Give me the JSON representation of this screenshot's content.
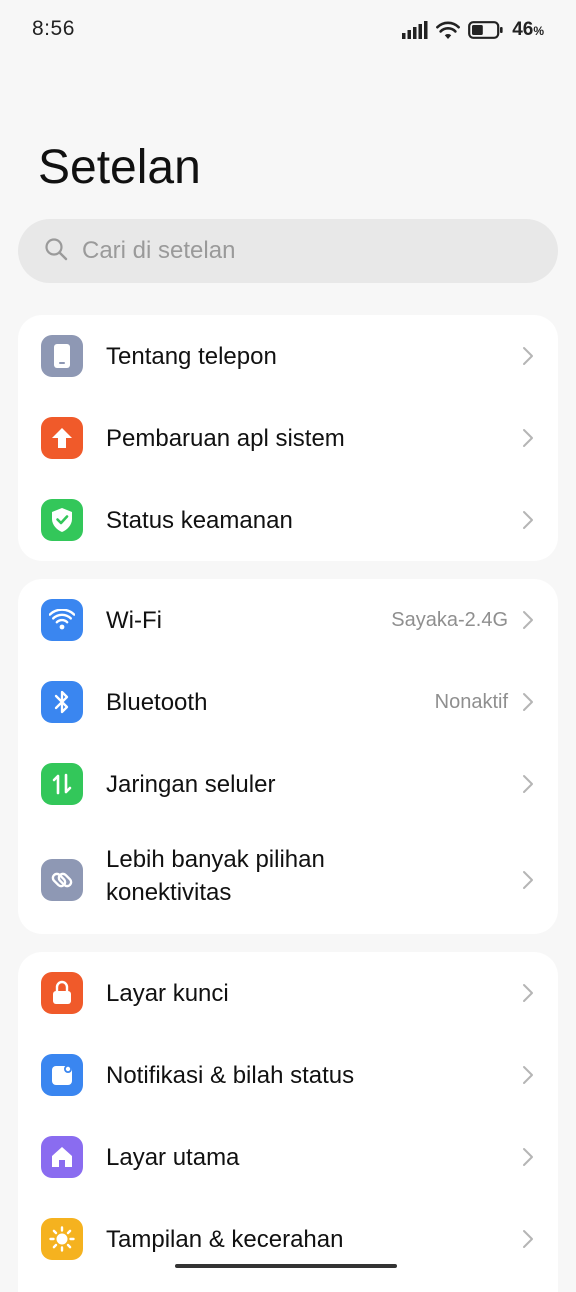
{
  "status_bar": {
    "time": "8:56",
    "battery_percent": "46",
    "battery_unit": "%",
    "battery_level": 0.46
  },
  "page": {
    "title": "Setelan"
  },
  "search": {
    "placeholder": "Cari di setelan"
  },
  "groups": [
    {
      "items": [
        {
          "label": "Tentang telepon",
          "icon": "phone-icon",
          "color": "#8e98b4"
        },
        {
          "label": "Pembaruan apl sistem",
          "icon": "upload-arrow-icon",
          "color": "#f05a2a"
        },
        {
          "label": "Status keamanan",
          "icon": "shield-check-icon",
          "color": "#33c75a"
        }
      ]
    },
    {
      "items": [
        {
          "label": "Wi-Fi",
          "value": "Sayaka-2.4G",
          "icon": "wifi-icon",
          "color": "#3a86f0"
        },
        {
          "label": "Bluetooth",
          "value": "Nonaktif",
          "icon": "bluetooth-icon",
          "color": "#3a86f0"
        },
        {
          "label": "Jaringan seluler",
          "icon": "mobile-data-icon",
          "color": "#33c75a"
        },
        {
          "label_line1": "Lebih banyak pilihan",
          "label_line2": "konektivitas",
          "icon": "link-icon",
          "color": "#8e98b4"
        }
      ]
    },
    {
      "items": [
        {
          "label": "Layar kunci",
          "icon": "lock-icon",
          "color": "#f05a2a"
        },
        {
          "label": "Notifikasi & bilah status",
          "icon": "notification-icon",
          "color": "#3a86f0"
        },
        {
          "label": "Layar utama",
          "icon": "home-icon",
          "color": "#8a6cf0"
        },
        {
          "label": "Tampilan & kecerahan",
          "icon": "sun-icon",
          "color": "#f5b21f"
        }
      ]
    }
  ]
}
